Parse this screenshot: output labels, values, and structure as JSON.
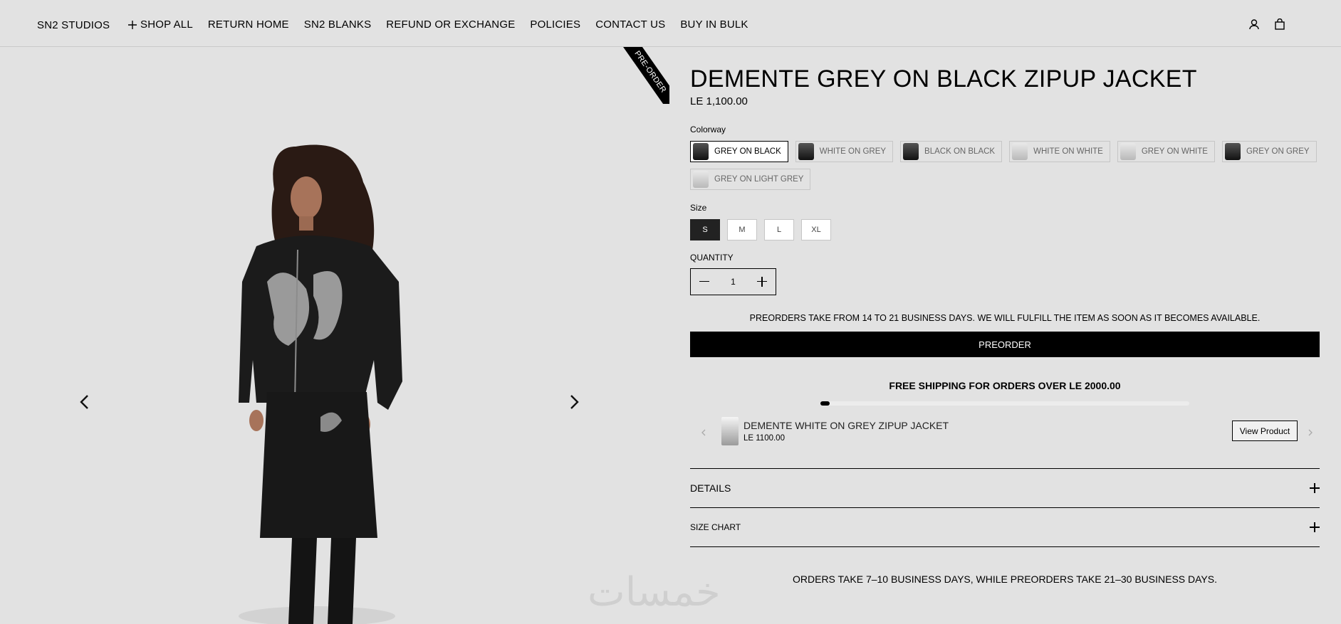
{
  "header": {
    "brand": "SN2 STUDIOS",
    "nav": [
      {
        "label": "SHOP ALL",
        "icon": "plus-icon"
      },
      {
        "label": "RETURN HOME"
      },
      {
        "label": "SN2 BLANKS"
      },
      {
        "label": "REFUND OR EXCHANGE"
      },
      {
        "label": "POLICIES"
      },
      {
        "label": "CONTACT US"
      },
      {
        "label": "BUY IN BULK"
      }
    ],
    "icons": [
      "account-icon",
      "cart-icon"
    ]
  },
  "gallery": {
    "ribbon": "PRE-ORDER",
    "prev_icon": "chevron-left-icon",
    "next_icon": "chevron-right-icon",
    "watermark": "خمسات"
  },
  "product": {
    "title": "DEMENTE GREY ON BLACK ZIPUP JACKET",
    "price": "LE 1,100.00",
    "colorway_label": "Colorway",
    "colorways": [
      {
        "label": "GREY ON BLACK",
        "selected": true,
        "thumb": "dark"
      },
      {
        "label": "WHITE ON GREY",
        "selected": false,
        "thumb": "dark"
      },
      {
        "label": "BLACK ON BLACK",
        "selected": false,
        "thumb": "dark"
      },
      {
        "label": "WHITE ON WHITE",
        "selected": false,
        "thumb": "light"
      },
      {
        "label": "GREY ON WHITE",
        "selected": false,
        "thumb": "light"
      },
      {
        "label": "GREY ON GREY",
        "selected": false,
        "thumb": "dark"
      },
      {
        "label": "GREY ON LIGHT GREY",
        "selected": false,
        "thumb": "light"
      }
    ],
    "size_label": "Size",
    "sizes": [
      {
        "label": "S",
        "selected": true
      },
      {
        "label": "M",
        "selected": false
      },
      {
        "label": "L",
        "selected": false
      },
      {
        "label": "XL",
        "selected": false
      }
    ],
    "quantity_label": "QUANTITY",
    "quantity": "1",
    "preorder_note": "PREORDERS TAKE FROM 14 TO 21 BUSINESS DAYS. WE WILL FULFILL THE ITEM AS SOON AS IT BECOMES AVAILABLE.",
    "preorder_button": "PREORDER",
    "shipping_text": "FREE SHIPPING FOR ORDERS OVER LE 2000.00",
    "shipping_progress": 0.02,
    "recommendation": {
      "name": "DEMENTE WHITE ON GREY ZIPUP JACKET",
      "price": "LE 1100.00",
      "button": "View Product"
    },
    "accordions": [
      "DETAILS",
      "SIZE CHART"
    ],
    "footnote": "ORDERS TAKE 7–10 BUSINESS DAYS, WHILE PREORDERS TAKE 21–30 BUSINESS DAYS."
  },
  "colors": {
    "accent": "#000000",
    "background": "#e2e2e2"
  }
}
